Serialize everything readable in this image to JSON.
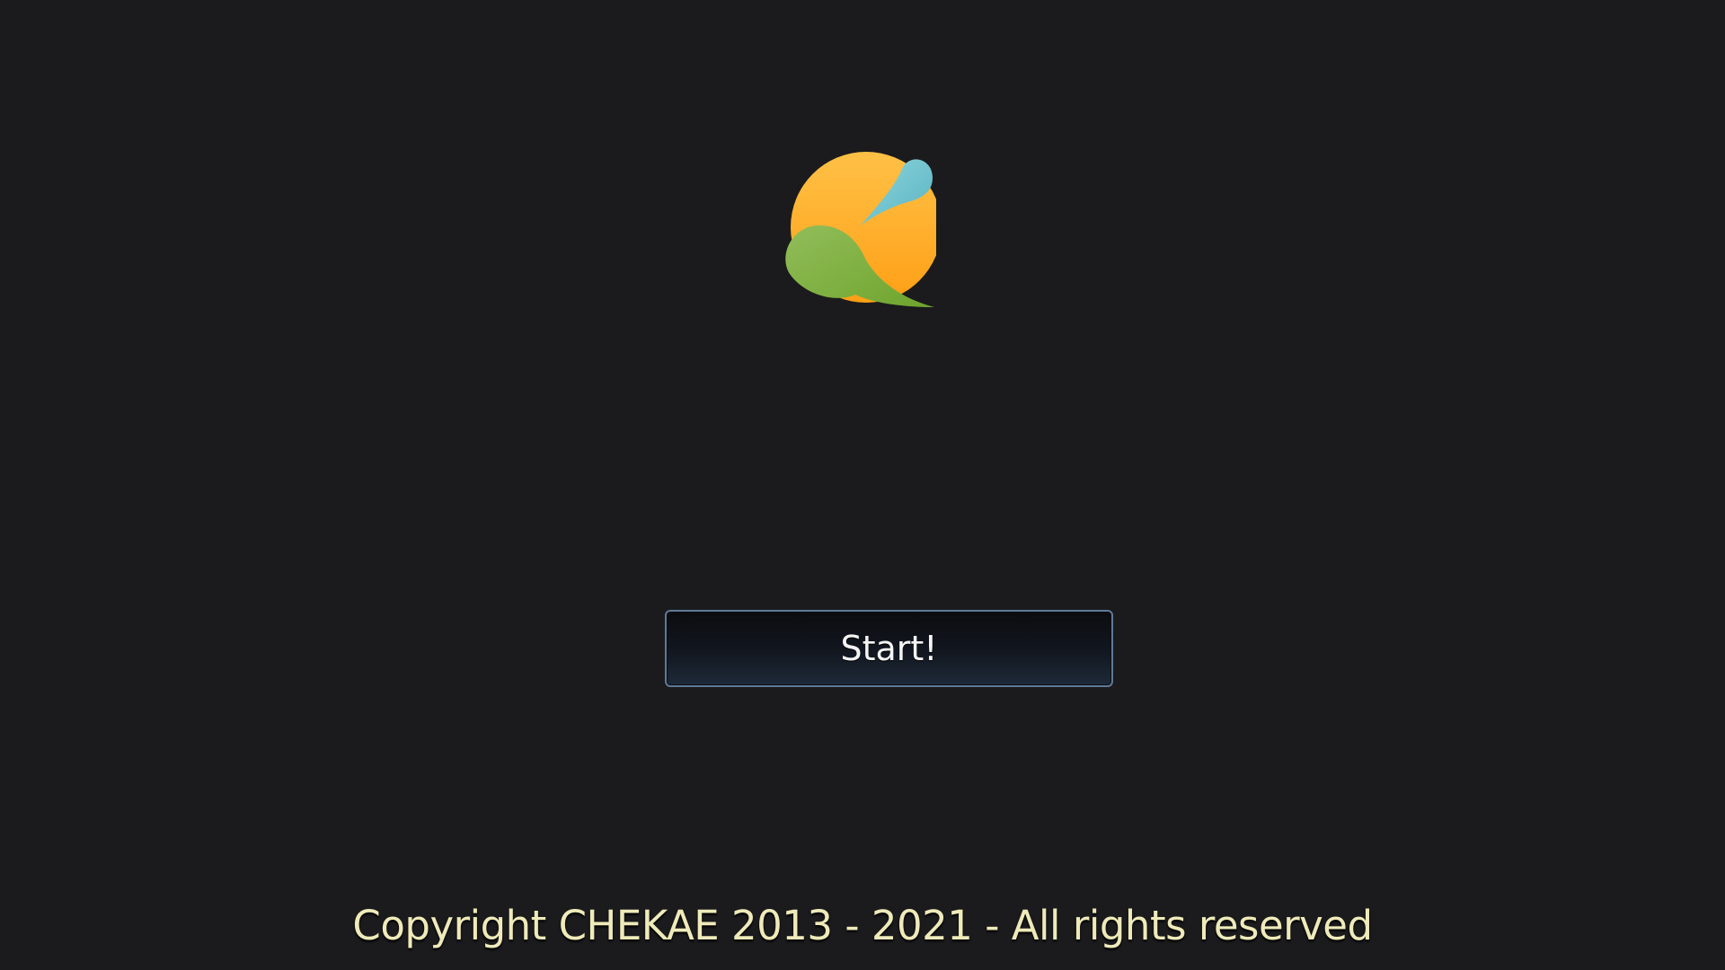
{
  "app": {
    "logo_icon": "orange-sun-leaf-logo-icon",
    "start_button_label": "Start!",
    "copyright_text": "Copyright CHEKAE 2013 - 2021 - All rights reserved"
  },
  "colors": {
    "background": "#1b1a1c",
    "button_border": "#5f7a98",
    "button_text": "#f4f4f4",
    "copyright_text": "#efeaba",
    "logo_orange": "#ffb733",
    "logo_green": "#8fba55",
    "logo_blue": "#78c8d2"
  }
}
